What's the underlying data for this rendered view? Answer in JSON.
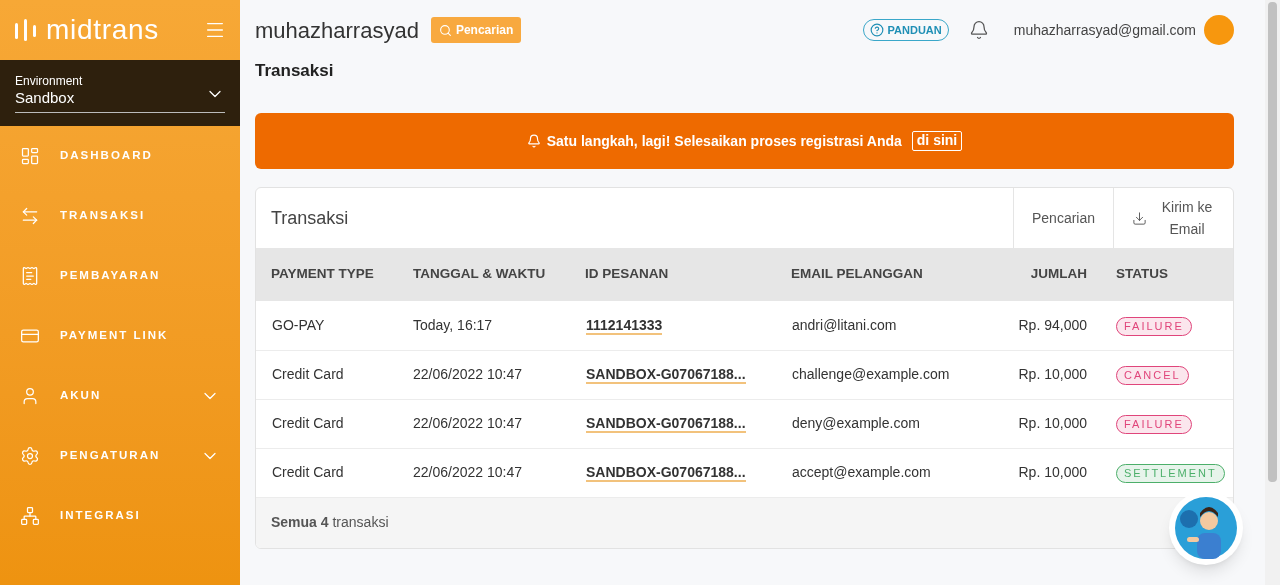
{
  "sidebar": {
    "logo": "midtrans",
    "environment": {
      "label": "Environment",
      "value": "Sandbox"
    },
    "items": [
      {
        "label": "DASHBOARD",
        "expandable": false
      },
      {
        "label": "TRANSAKSI",
        "expandable": false
      },
      {
        "label": "PEMBAYARAN",
        "expandable": false
      },
      {
        "label": "PAYMENT LINK",
        "expandable": false
      },
      {
        "label": "AKUN",
        "expandable": true
      },
      {
        "label": "PENGATURAN",
        "expandable": true
      },
      {
        "label": "INTEGRASI",
        "expandable": false
      }
    ]
  },
  "header": {
    "merchant": "muhazharrasyad",
    "search_button": "Pencarian",
    "help_button": "PANDUAN",
    "email": "muhazharrasyad@gmail.com"
  },
  "page_title": "Transaksi",
  "banner": {
    "text": "Satu langkah, lagi! Selesaikan proses registrasi Anda",
    "link": "di sini"
  },
  "table": {
    "title": "Transaksi",
    "search": "Pencarian",
    "export": "Kirim ke Email",
    "columns": [
      "PAYMENT TYPE",
      "TANGGAL & WAKTU",
      "ID PESANAN",
      "EMAIL PELANGGAN",
      "JUMLAH",
      "STATUS"
    ],
    "rows": [
      {
        "payment_type": "GO-PAY",
        "date": "Today, 16:17",
        "order_id": "1112141333",
        "email": "andri@litani.com",
        "amount": "Rp. 94,000",
        "status": "FAILURE",
        "color": "#e0457b"
      },
      {
        "payment_type": "Credit Card",
        "date": "22/06/2022 10:47",
        "order_id": "SANDBOX-G07067188...",
        "email": "challenge@example.com",
        "amount": "Rp. 10,000",
        "status": "CANCEL",
        "color": "#e0457b"
      },
      {
        "payment_type": "Credit Card",
        "date": "22/06/2022 10:47",
        "order_id": "SANDBOX-G07067188...",
        "email": "deny@example.com",
        "amount": "Rp. 10,000",
        "status": "FAILURE",
        "color": "#e0457b"
      },
      {
        "payment_type": "Credit Card",
        "date": "22/06/2022 10:47",
        "order_id": "SANDBOX-G07067188...",
        "email": "accept@example.com",
        "amount": "Rp. 10,000",
        "status": "SETTLEMENT",
        "color": "#4caf6a"
      }
    ],
    "footer": "**Semua 4** transaksi"
  }
}
